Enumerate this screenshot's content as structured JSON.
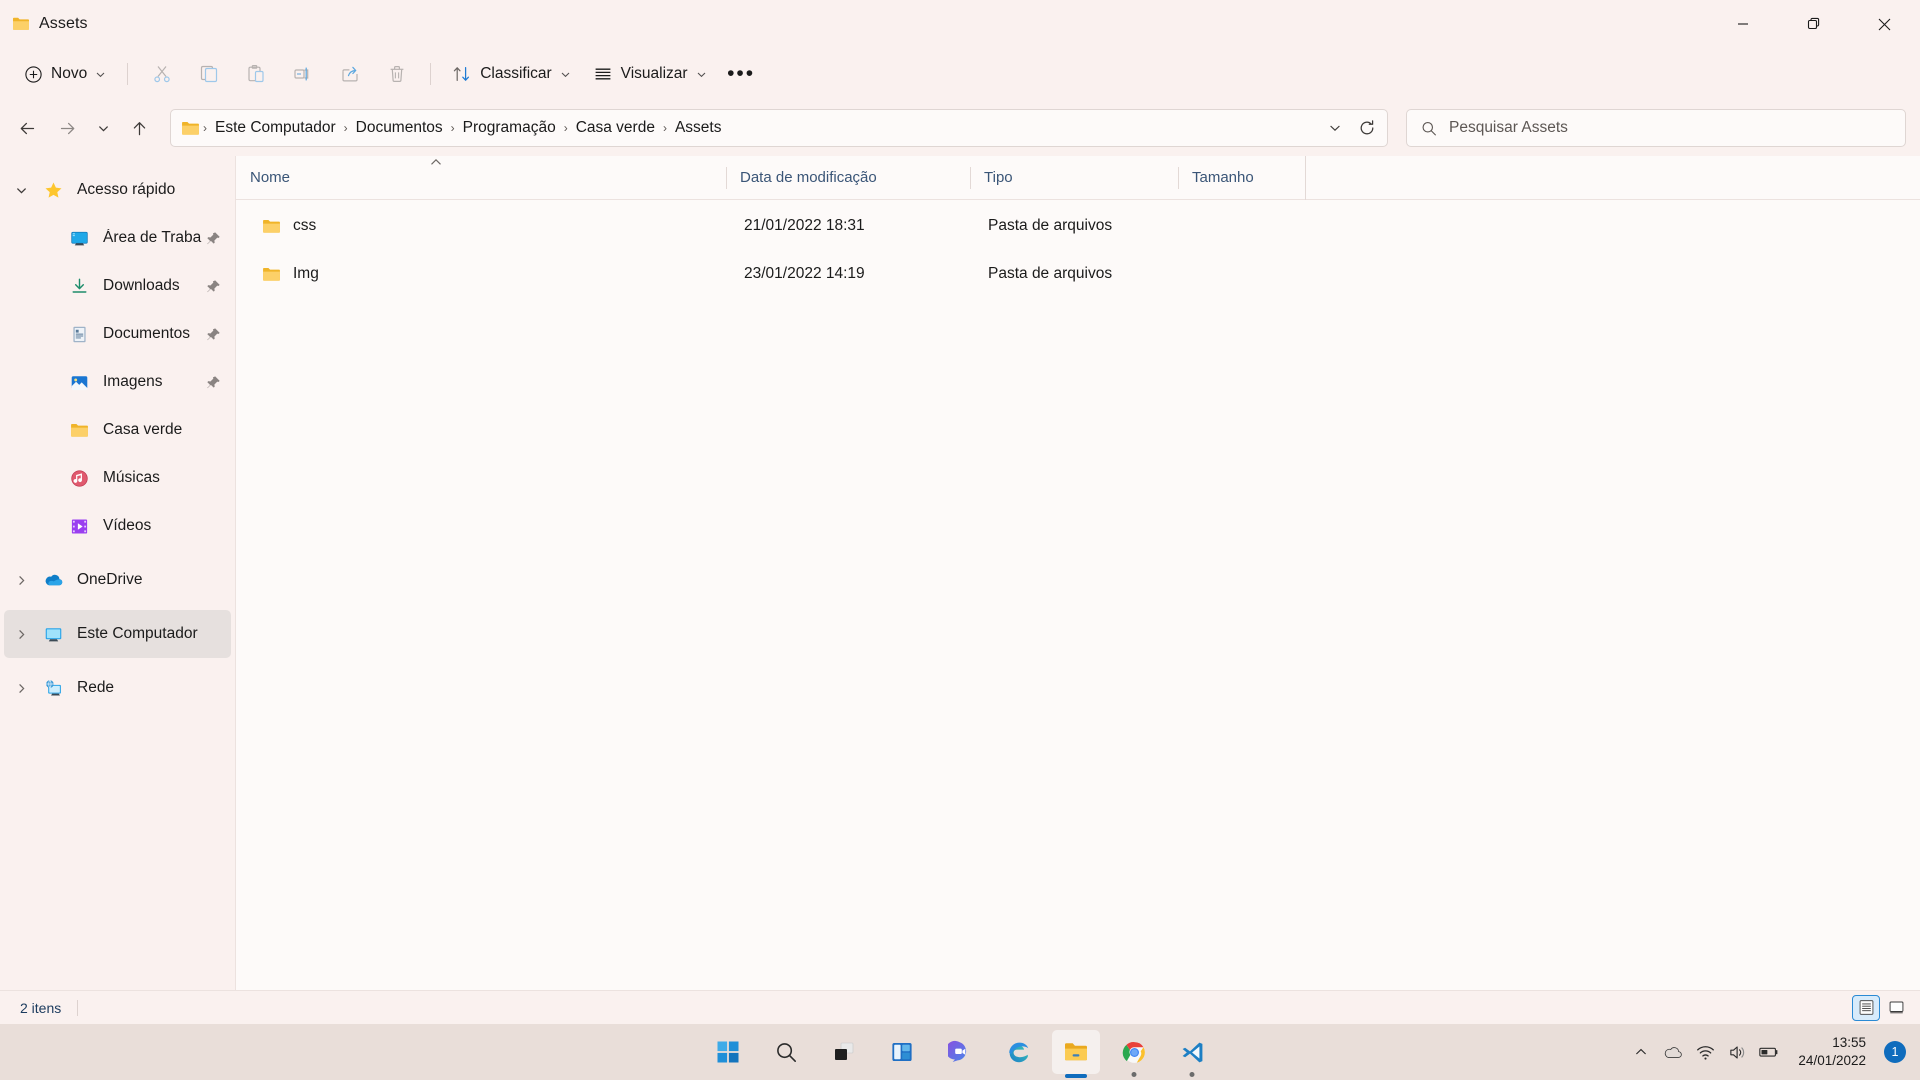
{
  "window": {
    "title": "Assets",
    "title_icon": "folder-icon",
    "controls": {
      "minimize": "minimize-icon",
      "maximize": "restore-icon",
      "close": "close-icon"
    }
  },
  "toolbar": {
    "new_label": "Novo",
    "sort_label": "Classificar",
    "view_label": "Visualizar",
    "more_label": "•••",
    "items": [
      {
        "name": "cut-button",
        "icon": "scissors-icon"
      },
      {
        "name": "copy-button",
        "icon": "copy-icon"
      },
      {
        "name": "paste-button",
        "icon": "paste-icon"
      },
      {
        "name": "rename-button",
        "icon": "rename-icon"
      },
      {
        "name": "share-button",
        "icon": "share-icon"
      },
      {
        "name": "delete-button",
        "icon": "trash-icon"
      }
    ]
  },
  "address": {
    "back": "back-arrow-icon",
    "forward": "forward-arrow-icon",
    "recent": "chevron-down-icon",
    "up": "up-arrow-icon",
    "crumb_icon": "folder-icon",
    "crumbs": [
      "Este Computador",
      "Documentos",
      "Programação",
      "Casa verde",
      "Assets"
    ],
    "separator": "›",
    "dropdown_icon": "chevron-down-icon",
    "refresh_icon": "refresh-icon"
  },
  "search": {
    "placeholder": "Pesquisar Assets",
    "value": "",
    "icon": "search-icon"
  },
  "sidebar": {
    "items": [
      {
        "label": "Acesso rápido",
        "icon": "star-icon",
        "expanded": true,
        "chevron": "chevron-down",
        "indent": false,
        "pinned": false,
        "selected": false,
        "name": "sidebar-item-acesso-rapido"
      },
      {
        "label": "Área de Trabalho",
        "icon": "desktop-icon",
        "chevron": "",
        "indent": true,
        "pinned": true,
        "selected": false,
        "name": "sidebar-item-area-de-trabalho"
      },
      {
        "label": "Downloads",
        "icon": "download-icon",
        "chevron": "",
        "indent": true,
        "pinned": true,
        "selected": false,
        "name": "sidebar-item-downloads"
      },
      {
        "label": "Documentos",
        "icon": "document-icon",
        "chevron": "",
        "indent": true,
        "pinned": true,
        "selected": false,
        "name": "sidebar-item-documentos"
      },
      {
        "label": "Imagens",
        "icon": "pictures-icon",
        "chevron": "",
        "indent": true,
        "pinned": true,
        "selected": false,
        "name": "sidebar-item-imagens"
      },
      {
        "label": "Casa verde",
        "icon": "folder-icon",
        "chevron": "",
        "indent": true,
        "pinned": false,
        "selected": false,
        "name": "sidebar-item-casa-verde"
      },
      {
        "label": "Músicas",
        "icon": "music-icon",
        "chevron": "",
        "indent": true,
        "pinned": false,
        "selected": false,
        "name": "sidebar-item-musicas"
      },
      {
        "label": "Vídeos",
        "icon": "video-icon",
        "chevron": "",
        "indent": true,
        "pinned": false,
        "selected": false,
        "name": "sidebar-item-videos"
      },
      {
        "label": "OneDrive",
        "icon": "onedrive-icon",
        "chevron": "chevron-right",
        "indent": false,
        "pinned": false,
        "selected": false,
        "name": "sidebar-item-onedrive"
      },
      {
        "label": "Este Computador",
        "icon": "this-pc-icon",
        "chevron": "chevron-right",
        "indent": false,
        "pinned": false,
        "selected": true,
        "name": "sidebar-item-este-computador"
      },
      {
        "label": "Rede",
        "icon": "network-icon",
        "chevron": "chevron-right",
        "indent": false,
        "pinned": false,
        "selected": false,
        "name": "sidebar-item-rede"
      }
    ]
  },
  "file_list": {
    "columns": [
      {
        "label": "Nome",
        "sorted": "asc"
      },
      {
        "label": "Data de modificação",
        "sorted": ""
      },
      {
        "label": "Tipo",
        "sorted": ""
      },
      {
        "label": "Tamanho",
        "sorted": ""
      }
    ],
    "rows": [
      {
        "name": "css",
        "icon": "folder-icon",
        "modified": "21/01/2022 18:31",
        "type": "Pasta de arquivos",
        "size": ""
      },
      {
        "name": "Img",
        "icon": "folder-icon",
        "modified": "23/01/2022 14:19",
        "type": "Pasta de arquivos",
        "size": ""
      }
    ]
  },
  "statusbar": {
    "count_text": "2 itens",
    "views": [
      {
        "name": "details-view-button",
        "icon": "list-view-icon",
        "active": true
      },
      {
        "name": "large-icons-view-button",
        "icon": "large-icon-view-icon",
        "active": false
      }
    ]
  },
  "taskbar": {
    "apps": [
      {
        "name": "start-button",
        "icon": "windows-logo-icon",
        "state": ""
      },
      {
        "name": "search-taskbar-button",
        "icon": "search-icon",
        "state": ""
      },
      {
        "name": "task-view-button",
        "icon": "task-view-icon",
        "state": ""
      },
      {
        "name": "widgets-button",
        "icon": "widgets-icon",
        "state": ""
      },
      {
        "name": "chat-button",
        "icon": "teams-chat-icon",
        "state": ""
      },
      {
        "name": "edge-button",
        "icon": "edge-icon",
        "state": ""
      },
      {
        "name": "file-explorer-button",
        "icon": "folder-icon",
        "state": "active"
      },
      {
        "name": "chrome-button",
        "icon": "chrome-icon",
        "state": "running"
      },
      {
        "name": "vscode-button",
        "icon": "vscode-icon",
        "state": "running"
      }
    ],
    "tray": {
      "overflow": "chevron-up-icon",
      "onedrive": "cloud-icon",
      "wifi": "wifi-icon",
      "volume": "speaker-icon",
      "battery": "battery-icon",
      "time": "13:55",
      "date": "24/01/2022",
      "notification_count": "1"
    }
  },
  "colors": {
    "window_bg": "#faf1ef",
    "content_bg": "#fdfaf9",
    "taskbar_bg": "#e9ded9",
    "accent": "#0f6cbd",
    "folder_yellow": "#f7c74c",
    "header_text": "#3a5577",
    "selection": "#e6e0de"
  }
}
